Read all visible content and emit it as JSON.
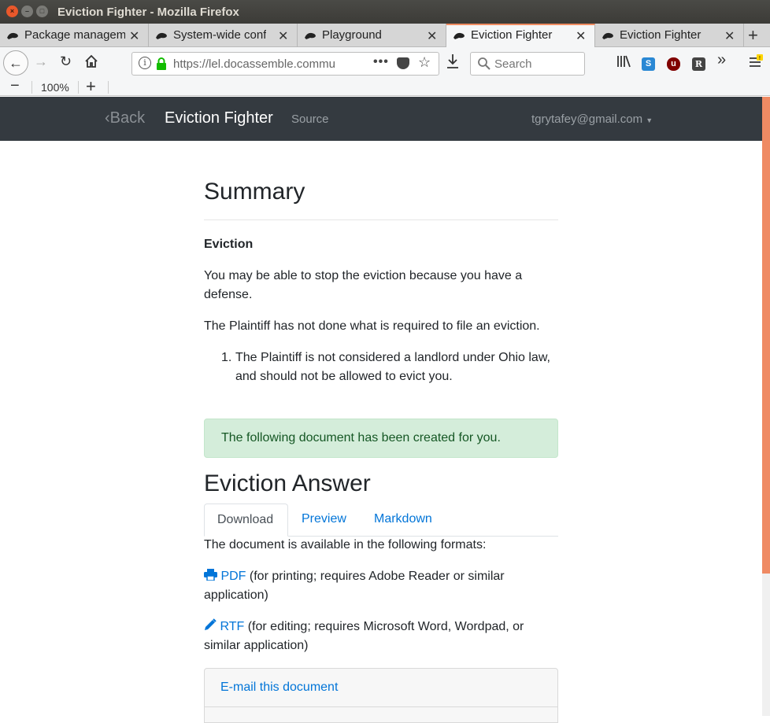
{
  "window": {
    "title": "Eviction Fighter - Mozilla Firefox"
  },
  "tabs": [
    {
      "label": "Package managem"
    },
    {
      "label": "System-wide confi"
    },
    {
      "label": "Playground"
    },
    {
      "label": "Eviction Fighter"
    },
    {
      "label": "Eviction Fighter"
    }
  ],
  "nav": {
    "url": "https://lel.docassemble.commu",
    "search_placeholder": "Search",
    "zoom": "100%"
  },
  "app": {
    "back": "Back",
    "brand": "Eviction Fighter",
    "source": "Source",
    "user": "tgrytafey@gmail.com"
  },
  "content": {
    "summary_heading": "Summary",
    "section_title": "Eviction",
    "para1": "You may be able to stop the eviction because you have a defense.",
    "para2": "The Plaintiff has not done what is required to file an eviction.",
    "list_item_1": "The Plaintiff is not considered a landlord under Ohio law, and should not be allowed to evict you.",
    "alert": "The following document has been created for you.",
    "doc_heading": "Eviction Answer",
    "doc_tabs": [
      "Download",
      "Preview",
      "Markdown"
    ],
    "formats_intro": "The document is available in the following formats:",
    "pdf_label": "PDF",
    "pdf_desc": "(for printing; requires Adobe Reader or similar application)",
    "rtf_label": "RTF",
    "rtf_desc": "(for editing; requires Microsoft Word, Wordpad, or similar application)",
    "email_label": "E-mail this document"
  },
  "colors": {
    "accent": "#0275d8",
    "navbar": "#343a40",
    "alert_bg": "#d4edda",
    "tab_highlight": "#f08c60"
  }
}
